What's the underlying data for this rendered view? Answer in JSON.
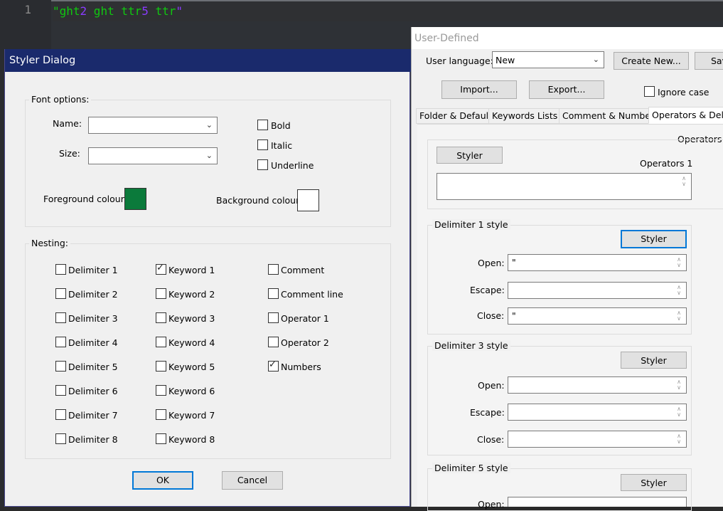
{
  "editor": {
    "line_number": "1",
    "code_tokens": [
      {
        "text": "\"ght",
        "color": "green"
      },
      {
        "text": "2",
        "color": "purple"
      },
      {
        "text": " ght ttr",
        "color": "green"
      },
      {
        "text": "5",
        "color": "purple"
      },
      {
        "text": " ttr",
        "color": "green"
      },
      {
        "text": "\"",
        "color": "purple"
      }
    ]
  },
  "user_defined": {
    "title": "User-Defined",
    "user_language_label": "User language:",
    "user_language_value": "New",
    "create_new_label": "Create New...",
    "save_label": "Sav",
    "import_label": "Import...",
    "export_label": "Export...",
    "ignore_case_label": "Ignore case",
    "tabs": [
      "Folder & Default",
      "Keywords Lists",
      "Comment & Number",
      "Operators & Deli"
    ],
    "operators_section_label": "Operators s",
    "styler_label": "Styler",
    "operators1_label": "Operators 1",
    "delimiters": [
      {
        "title": "Delimiter 1 style",
        "open_label": "Open:",
        "open_value": "\"",
        "escape_label": "Escape:",
        "escape_value": "",
        "close_label": "Close:",
        "close_value": "\""
      },
      {
        "title": "Delimiter 3 style",
        "open_label": "Open:",
        "open_value": "",
        "escape_label": "Escape:",
        "escape_value": "",
        "close_label": "Close:",
        "close_value": ""
      },
      {
        "title": "Delimiter 5 style",
        "open_label": "Open:",
        "open_value": ""
      }
    ]
  },
  "styler": {
    "title": "Styler Dialog",
    "font_options_label": "Font options:",
    "name_label": "Name:",
    "size_label": "Size:",
    "bold_label": "Bold",
    "italic_label": "Italic",
    "underline_label": "Underline",
    "foreground_label": "Foreground colour",
    "background_label": "Background colour",
    "foreground_color": "#0b7a3b",
    "background_color": "#ffffff",
    "nesting_label": "Nesting:",
    "nesting_col1": [
      "Delimiter 1",
      "Delimiter 2",
      "Delimiter 3",
      "Delimiter 4",
      "Delimiter 5",
      "Delimiter 6",
      "Delimiter 7",
      "Delimiter 8"
    ],
    "nesting_col2": [
      "Keyword 1",
      "Keyword 2",
      "Keyword 3",
      "Keyword 4",
      "Keyword 5",
      "Keyword 6",
      "Keyword 7",
      "Keyword 8"
    ],
    "nesting_col3": [
      "Comment",
      "Comment line",
      "Operator 1",
      "Operator 2",
      "Numbers"
    ],
    "checked": [
      "Keyword 1",
      "Numbers"
    ],
    "ok_label": "OK",
    "cancel_label": "Cancel"
  }
}
